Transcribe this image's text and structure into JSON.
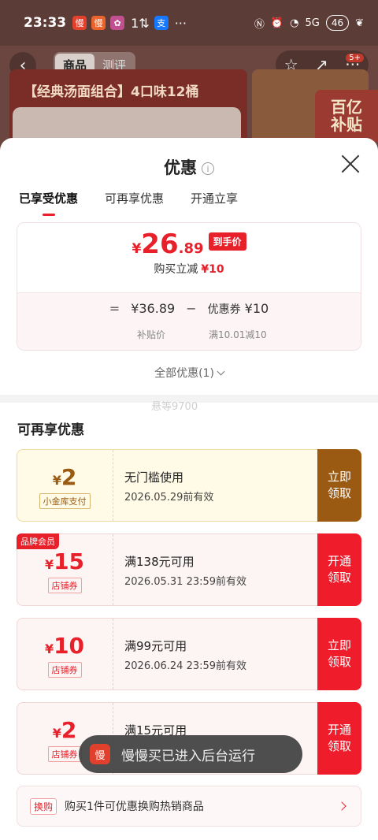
{
  "status_bar": {
    "time": "23:33",
    "net": "1⇅",
    "alipay": "支",
    "more": "···",
    "signal": "5G",
    "battery": "46"
  },
  "product_page": {
    "tabs": [
      "商品",
      "测评"
    ],
    "cart_badge": "5+",
    "banner_title": "【经典汤面组合】4口味12桶",
    "subsidy_line1": "百亿",
    "subsidy_line2": "补贴"
  },
  "sheet": {
    "title": "优惠",
    "info_glyph": "i",
    "tabs": [
      "已享受优惠",
      "可再享优惠",
      "开通立享"
    ],
    "final_price": {
      "currency": "¥",
      "integer": "26",
      "decimal": ".89",
      "tag": "到手价"
    },
    "instant_discount": {
      "label": "购买立减",
      "amount": "¥10"
    },
    "formula": {
      "eq": "=",
      "subsidy_price": "¥36.89",
      "minus": "−",
      "coupon_label": "优惠券",
      "coupon_amount": "¥10",
      "subsidy_caption": "补贴价",
      "coupon_caption": "满10.01减10"
    },
    "all_promos": "全部优惠(1)",
    "watermark": "悬等9700",
    "section_title": "可再享优惠"
  },
  "coupons": [
    {
      "currency": "¥",
      "value": "2",
      "kind": "小金库支付",
      "condition": "无门槛使用",
      "expiry": "2026.05.29前有效",
      "button": "立即\n领取",
      "badge": ""
    },
    {
      "currency": "¥",
      "value": "15",
      "kind": "店铺券",
      "condition": "满138元可用",
      "expiry": "2026.05.31 23:59前有效",
      "button": "开通\n领取",
      "badge": "品牌会员"
    },
    {
      "currency": "¥",
      "value": "10",
      "kind": "店铺券",
      "condition": "满99元可用",
      "expiry": "2026.06.24 23:59前有效",
      "button": "立即\n领取",
      "badge": ""
    },
    {
      "currency": "¥",
      "value": "2",
      "kind": "店铺券",
      "condition": "满15元可用",
      "expiry": "",
      "button": "开通\n领取",
      "badge": ""
    }
  ],
  "toast": {
    "icon_text": "慢",
    "text": "慢慢买已进入后台运行"
  },
  "exchange": {
    "tag": "换购",
    "text": "购买1件可优惠换购热销商品"
  },
  "colors": {
    "accent": "#e8202a",
    "gold": "#9b5a12",
    "overlay": "#6b4a42"
  }
}
